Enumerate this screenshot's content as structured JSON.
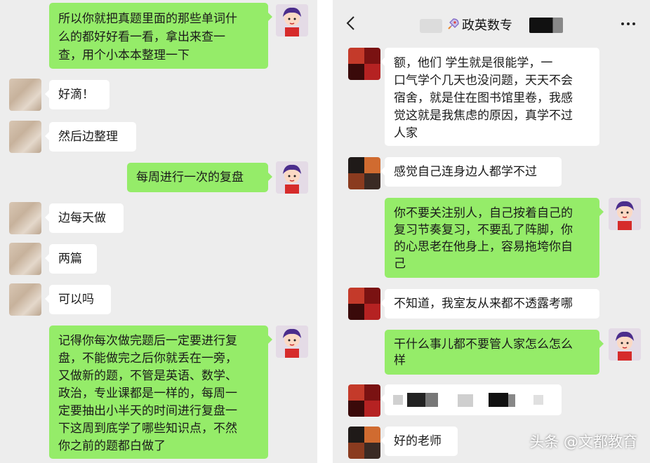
{
  "left_chat": {
    "messages": [
      {
        "side": "out",
        "avatar": "cartoon-girl-avatar",
        "text": "所以你就把真题里面的那些单词什\n么的都好好看一看，拿出来查一\n查，用个小本本整理一下"
      },
      {
        "side": "in",
        "avatar": "beige-blurred-avatar",
        "text": "好滴！"
      },
      {
        "side": "in",
        "avatar": "beige-blurred-avatar",
        "text": "然后边整理"
      },
      {
        "side": "out",
        "avatar": "cartoon-girl-avatar",
        "text": "每周进行一次的复盘"
      },
      {
        "side": "in",
        "avatar": "beige-blurred-avatar",
        "text": "边每天做"
      },
      {
        "side": "in",
        "avatar": "beige-blurred-avatar",
        "text": "两篇"
      },
      {
        "side": "in",
        "avatar": "beige-blurred-avatar",
        "text": "可以吗"
      },
      {
        "side": "out",
        "avatar": "cartoon-girl-avatar",
        "text": "记得你每次做完题后一定要进行复\n盘，不能做完之后你就丢在一旁，\n又做新的题，不管是英语、数学、\n政治，专业课都是一样的，每周一\n定要抽出小半天的时间进行复盘一\n下这周到底学了哪些知识点，不然\n你之前的题都白做了"
      }
    ]
  },
  "right_chat": {
    "header": {
      "back_icon": "chevron-left-icon",
      "title": "政英数专",
      "more_icon": "more-dots-icon"
    },
    "messages": [
      {
        "side": "in",
        "avatar": "pixelated-red-avatar",
        "text": "额，他们    学生就是很能学，一\n口气学个几天也没问题，天天不会\n宿舍，就是住在图书馆里卷，我感\n觉这就是我焦虑的原因，真学不过\n人家"
      },
      {
        "side": "in",
        "avatar": "pixelated-orange-avatar",
        "text": "感觉自己连身边人都学不过"
      },
      {
        "side": "out",
        "avatar": "cartoon-girl-avatar",
        "text": "你不要关注别人，自己按着自己的\n复习节奏复习，不要乱了阵脚，你\n的心思老在他身上，容易拖垮你自\n己"
      },
      {
        "side": "in",
        "avatar": "pixelated-red-avatar",
        "text": "不知道，我室友从来都不透露考哪"
      },
      {
        "side": "out",
        "avatar": "cartoon-girl-avatar",
        "text": "干什么事儿都不要管人家怎么怎么\n样"
      },
      {
        "side": "in",
        "avatar": "pixelated-red-avatar",
        "text": ""
      },
      {
        "side": "in",
        "avatar": "pixelated-orange-avatar",
        "text": "好的老师"
      }
    ]
  },
  "watermark": "头条 @文都教育",
  "colors": {
    "outgoing_bubble": "#95ec69",
    "incoming_bubble": "#ffffff",
    "background": "#ededed"
  }
}
